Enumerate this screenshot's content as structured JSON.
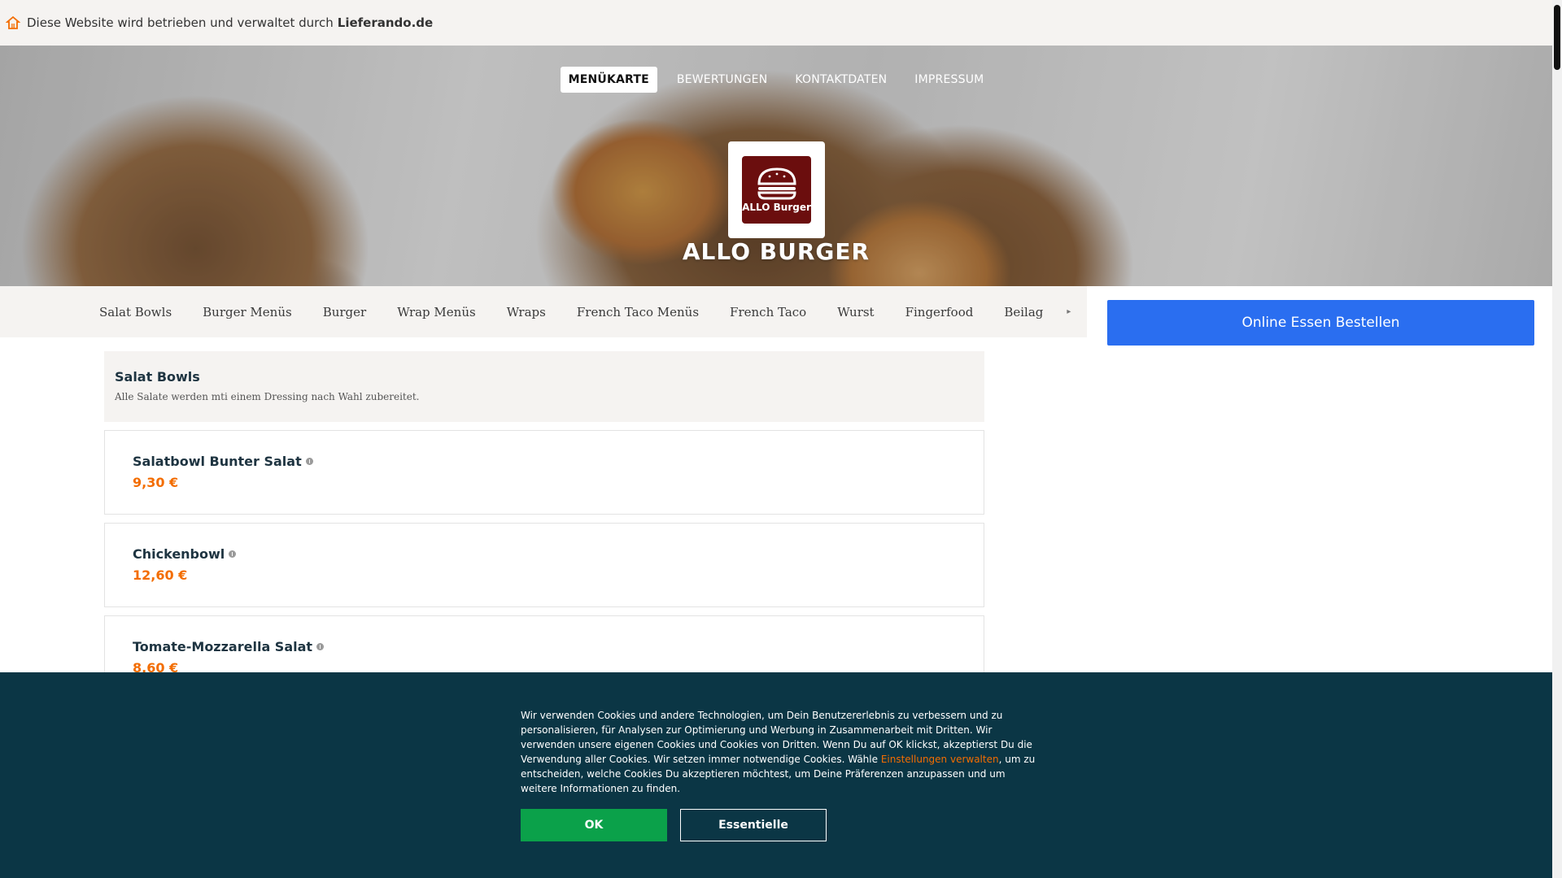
{
  "notice": {
    "text": "Diese Website wird betrieben und verwaltet durch",
    "brand": "Lieferando.de"
  },
  "top_nav": [
    {
      "label": "MENÜKARTE",
      "active": true
    },
    {
      "label": "BEWERTUNGEN",
      "active": false
    },
    {
      "label": "KONTAKTDATEN",
      "active": false
    },
    {
      "label": "IMPRESSUM",
      "active": false
    }
  ],
  "restaurant": {
    "logo_text": "ALLO Burger",
    "name": "ALLO BURGER",
    "logo_color": "#6b0e0e"
  },
  "categories": [
    "Salat Bowls",
    "Burger Menüs",
    "Burger",
    "Wrap Menüs",
    "Wraps",
    "French Taco Menüs",
    "French Taco",
    "Wurst",
    "Fingerfood",
    "Beilag"
  ],
  "order_button": {
    "label": "Online Essen Bestellen",
    "color": "#2a6ef0"
  },
  "section": {
    "title": "Salat Bowls",
    "description": "Alle Salate werden mti einem Dressing nach Wahl zubereitet."
  },
  "items": [
    {
      "name": "Salatbowl Bunter Salat",
      "price": "9,30 €"
    },
    {
      "name": "Chickenbowl",
      "price": "12,60 €"
    },
    {
      "name": "Tomate-Mozzarella Salat",
      "price": "8,60 €"
    }
  ],
  "cookie": {
    "text_before": "Wir verwenden Cookies und andere Technologien, um Dein Benutzererlebnis zu verbessern und zu personalisieren, für Analysen zur Optimierung und Werbung in Zusammenarbeit mit Dritten. Wir verwenden unsere eigenen Cookies und Cookies von Dritten. Wenn Du auf OK klickst, akzeptierst Du die Verwendung aller Cookies. Wir setzen immer notwendige Cookies. Wähle ",
    "link": "Einstellungen verwalten",
    "text_after": ", um zu entscheiden, welche Cookies Du akzeptieren möchtest, um Deine Präferenzen anzupassen und um weitere Informationen zu finden.",
    "ok_label": "OK",
    "essential_label": "Essentielle",
    "background": "#0b3645",
    "ok_color": "#0ba14a"
  },
  "colors": {
    "accent": "#f36d00",
    "heading": "#1e3441"
  }
}
